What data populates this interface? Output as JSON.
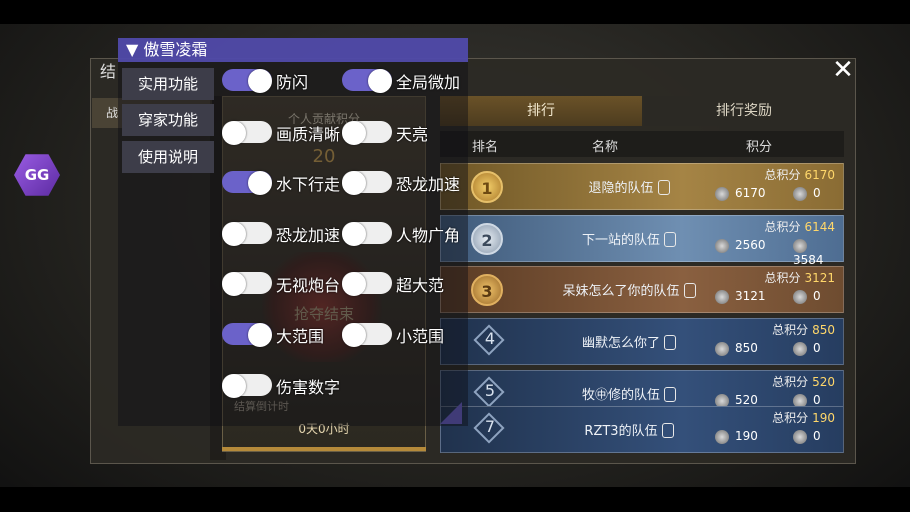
{
  "game": {
    "window_title": "结",
    "close_label": "✕",
    "left_tab": "战",
    "tabs": [
      "排行",
      "排行奖励"
    ],
    "columns": [
      "排名",
      "名称",
      "积分"
    ],
    "mid_panel": {
      "header": "个人贡献积分",
      "value": "20",
      "end_text": "抢夺结束",
      "countdown_label": "结算倒计时",
      "countdown_value": "0天0小时"
    },
    "total_label": "总积分",
    "rows": [
      {
        "rank": "1",
        "name": "退隐的队伍",
        "total": "6170",
        "score1": "6170",
        "score2": "0",
        "style": "gold"
      },
      {
        "rank": "2",
        "name": "下一站的队伍",
        "total": "6144",
        "score1": "2560",
        "score2": "3584",
        "style": "silver"
      },
      {
        "rank": "3",
        "name": "呆妹怎么了你的队伍",
        "total": "3121",
        "score1": "3121",
        "score2": "0",
        "style": "bronze"
      },
      {
        "rank": "4",
        "name": "幽默怎么你了",
        "total": "850",
        "score1": "850",
        "score2": "0",
        "style": "blue"
      },
      {
        "rank": "5",
        "name": "牧㊥修的队伍",
        "total": "520",
        "score1": "520",
        "score2": "0",
        "style": "blue"
      },
      {
        "rank": "7",
        "name": "RZT3的队伍",
        "total": "190",
        "score1": "190",
        "score2": "0",
        "style": "blue"
      }
    ]
  },
  "gg_icon_label": "GG",
  "menu": {
    "title": "▼ 傲雪凌霜",
    "side_buttons": [
      "实用功能",
      "穿家功能",
      "使用说明"
    ],
    "toggles": [
      {
        "label": "防闪",
        "on": true
      },
      {
        "label": "全局微加",
        "on": true
      },
      {
        "label": "画质清晰",
        "on": false
      },
      {
        "label": "天亮",
        "on": false
      },
      {
        "label": "水下行走",
        "on": true
      },
      {
        "label": "恐龙加速",
        "on": false
      },
      {
        "label": "恐龙加速",
        "on": false
      },
      {
        "label": "人物广角",
        "on": false
      },
      {
        "label": "无视炮台",
        "on": false
      },
      {
        "label": "超大范",
        "on": false
      },
      {
        "label": "大范围",
        "on": true
      },
      {
        "label": "小范围",
        "on": false
      },
      {
        "label": "伤害数字",
        "on": false
      }
    ]
  }
}
